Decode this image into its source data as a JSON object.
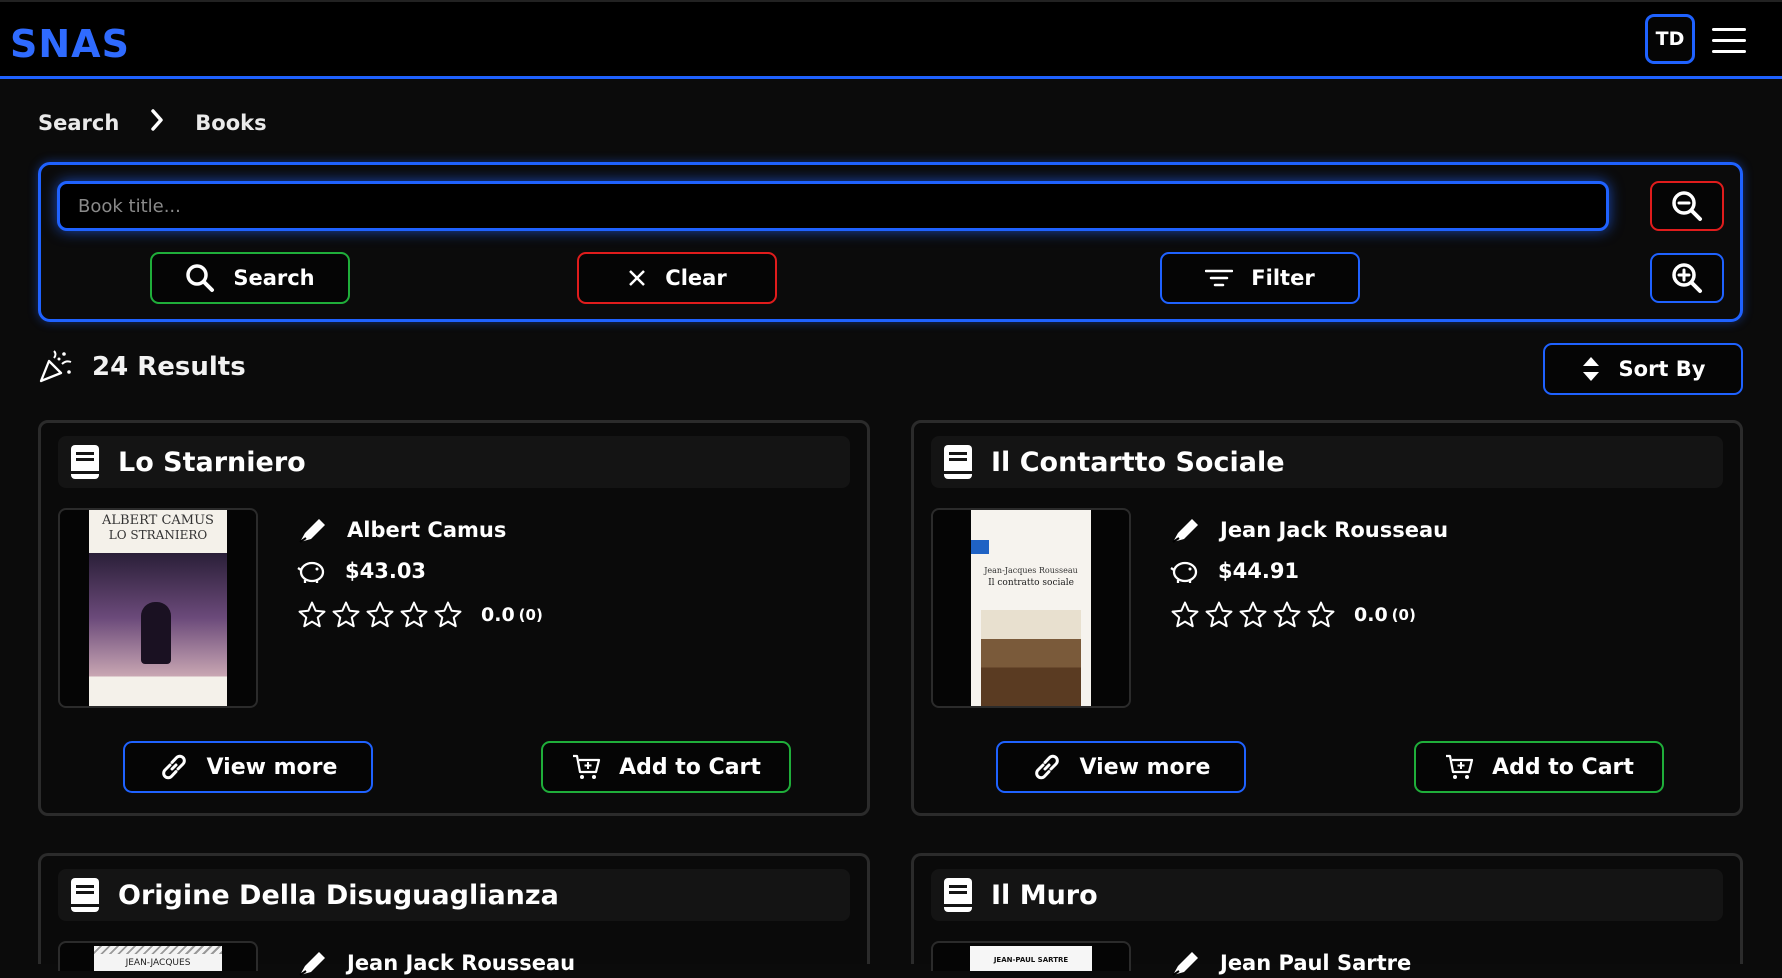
{
  "app": {
    "logo": "SNAS",
    "avatar_initials": "TD"
  },
  "breadcrumb": {
    "items": [
      "Search",
      "Books"
    ]
  },
  "search": {
    "placeholder": "Book title...",
    "value": "",
    "search_label": "Search",
    "clear_label": "Clear",
    "filter_label": "Filter"
  },
  "results": {
    "label": "24 Results",
    "sort_label": "Sort By"
  },
  "books": [
    {
      "title": "Lo Starniero",
      "author": "Albert Camus",
      "price": "$43.03",
      "rating": "0.0",
      "rating_count": "(0)",
      "cover_line1": "ALBERT CAMUS",
      "cover_line2": "LO STRANIERO",
      "view_label": "View more",
      "cart_label": "Add to Cart"
    },
    {
      "title": "Il Contartto Sociale",
      "author": "Jean Jack Rousseau",
      "price": "$44.91",
      "rating": "0.0",
      "rating_count": "(0)",
      "cover_line1": "Jean-Jacques Rousseau",
      "cover_line2": "Il contratto sociale",
      "view_label": "View more",
      "cart_label": "Add to Cart"
    },
    {
      "title": "Origine Della Disuguaglianza",
      "author": "Jean Jack Rousseau",
      "cover_line1": "JEAN-JACQUES"
    },
    {
      "title": "Il Muro",
      "author": "Jean Paul Sartre",
      "cover_line1": "JEAN-PAUL SARTRE"
    }
  ],
  "colors": {
    "accent": "#1f62ff",
    "success": "#1fae3a",
    "danger": "#e01c1c"
  },
  "icons": [
    "menu-icon",
    "chevron-right-icon",
    "zoom-out-icon",
    "zoom-in-icon",
    "search-icon",
    "close-icon",
    "filter-icon",
    "confetti-icon",
    "sort-icon",
    "book-icon",
    "pen-icon",
    "piggy-bank-icon",
    "star-icon",
    "link-icon",
    "cart-icon"
  ]
}
